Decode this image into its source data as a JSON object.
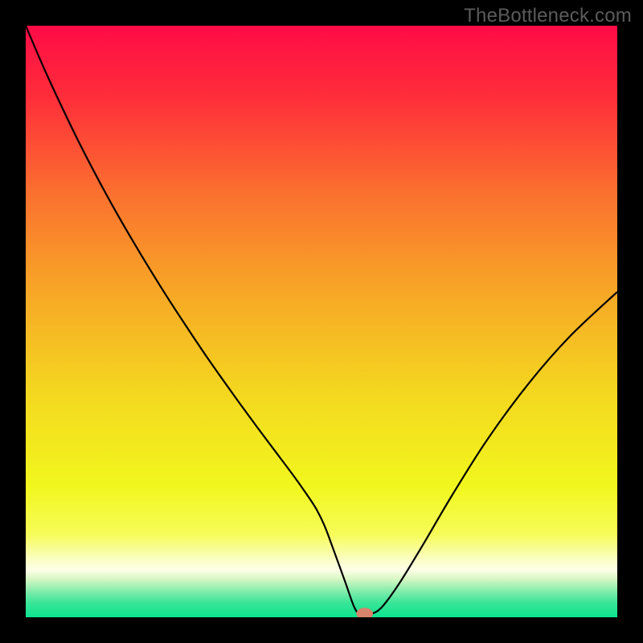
{
  "watermark": "TheBottleneck.com",
  "chart_data": {
    "type": "line",
    "title": "",
    "xlabel": "",
    "ylabel": "",
    "xlim": [
      0,
      100
    ],
    "ylim": [
      0,
      100
    ],
    "background_gradient": {
      "stops": [
        {
          "offset": 0.0,
          "color": "#ff0b46"
        },
        {
          "offset": 0.12,
          "color": "#ff2d3a"
        },
        {
          "offset": 0.28,
          "color": "#fb6f2f"
        },
        {
          "offset": 0.45,
          "color": "#f7a726"
        },
        {
          "offset": 0.62,
          "color": "#f4d71f"
        },
        {
          "offset": 0.78,
          "color": "#f1f71e"
        },
        {
          "offset": 0.86,
          "color": "#f6fc58"
        },
        {
          "offset": 0.905,
          "color": "#fbfeca"
        },
        {
          "offset": 0.92,
          "color": "#fdfee7"
        },
        {
          "offset": 0.935,
          "color": "#d8f7c4"
        },
        {
          "offset": 0.955,
          "color": "#86edac"
        },
        {
          "offset": 0.975,
          "color": "#3be598"
        },
        {
          "offset": 1.0,
          "color": "#0be38f"
        }
      ]
    },
    "series": [
      {
        "name": "bottleneck-curve",
        "color": "#000000",
        "x": [
          0,
          3,
          6,
          9,
          12,
          15,
          18,
          21,
          24,
          27,
          30,
          33,
          36,
          39,
          42,
          45,
          47,
          49,
          50.5,
          52,
          54,
          55.5,
          56.5,
          58,
          60,
          63,
          67,
          72,
          78,
          85,
          92,
          100
        ],
        "y": [
          100,
          93,
          86.5,
          80.3,
          74.5,
          69,
          63.8,
          58.8,
          54,
          49.4,
          44.9,
          40.6,
          36.4,
          32.3,
          28.3,
          24.3,
          21.5,
          18.5,
          15.5,
          11.5,
          6.0,
          1.8,
          0.5,
          0.5,
          1.5,
          5.5,
          12.0,
          20.5,
          30.0,
          39.5,
          47.5,
          55.0
        ]
      }
    ],
    "marker": {
      "name": "optimum-point",
      "x": 57.3,
      "y": 0.6,
      "color": "#d8836c",
      "rx": 1.4,
      "ry": 1.0
    }
  }
}
